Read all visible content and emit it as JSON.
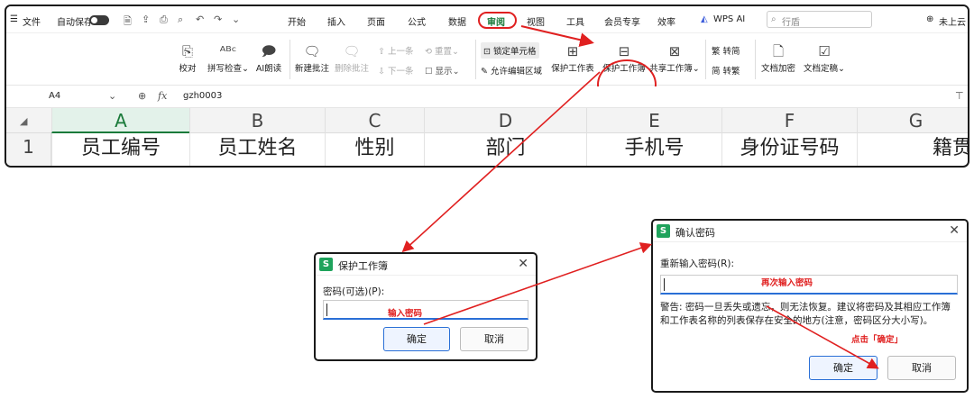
{
  "menubar": {
    "file": "文件",
    "autosave": "自动保存",
    "tabs": [
      "开始",
      "插入",
      "页面",
      "公式",
      "数据",
      "审阅",
      "视图",
      "工具",
      "会员专享",
      "效率"
    ],
    "wps_ai": "WPS AI",
    "search_placeholder": "行盾",
    "cloud": "未上云"
  },
  "toolbar": {
    "proof": "校对",
    "spell": "拼写检查",
    "ai_read": "AI朗读",
    "new_comment": "新建批注",
    "delete_comment": "删除批注",
    "prev": "上一条",
    "next": "下一条",
    "reset": "重置",
    "show": "显示",
    "lock_cell": "锁定单元格",
    "allow_edit": "允许编辑区域",
    "protect_sheet": "保护工作表",
    "protect_book": "保护工作簿",
    "share_book": "共享工作簿",
    "to_simplified": "转简",
    "to_traditional": "转繁",
    "doc_encrypt": "文档加密",
    "doc_final": "文档定稿"
  },
  "formula_bar": {
    "cell_ref": "A4",
    "formula": "gzh0003"
  },
  "sheet": {
    "columns": [
      "A",
      "B",
      "C",
      "D",
      "E",
      "F",
      "G"
    ],
    "row_number": "1",
    "row1": [
      "员工编号",
      "员工姓名",
      "性别",
      "部门",
      "手机号",
      "身份证号码",
      "籍贯"
    ]
  },
  "dialog_protect": {
    "title": "保护工作簿",
    "label": "密码(可选)(P):",
    "note": "输入密码",
    "ok": "确定",
    "cancel": "取消"
  },
  "dialog_confirm": {
    "title": "确认密码",
    "label": "重新输入密码(R):",
    "note": "再次输入密码",
    "warning": "警告: 密码一旦丢失或遗忘，则无法恢复。建议将密码及其相应工作簿和工作表名称的列表保存在安全的地方(注意，密码区分大小写)。",
    "click_note": "点击「确定」",
    "ok": "确定",
    "cancel": "取消"
  },
  "colors": {
    "highlight": "#e02020",
    "brand_green": "#1fa35c",
    "accent_blue": "#2a6fd6"
  }
}
